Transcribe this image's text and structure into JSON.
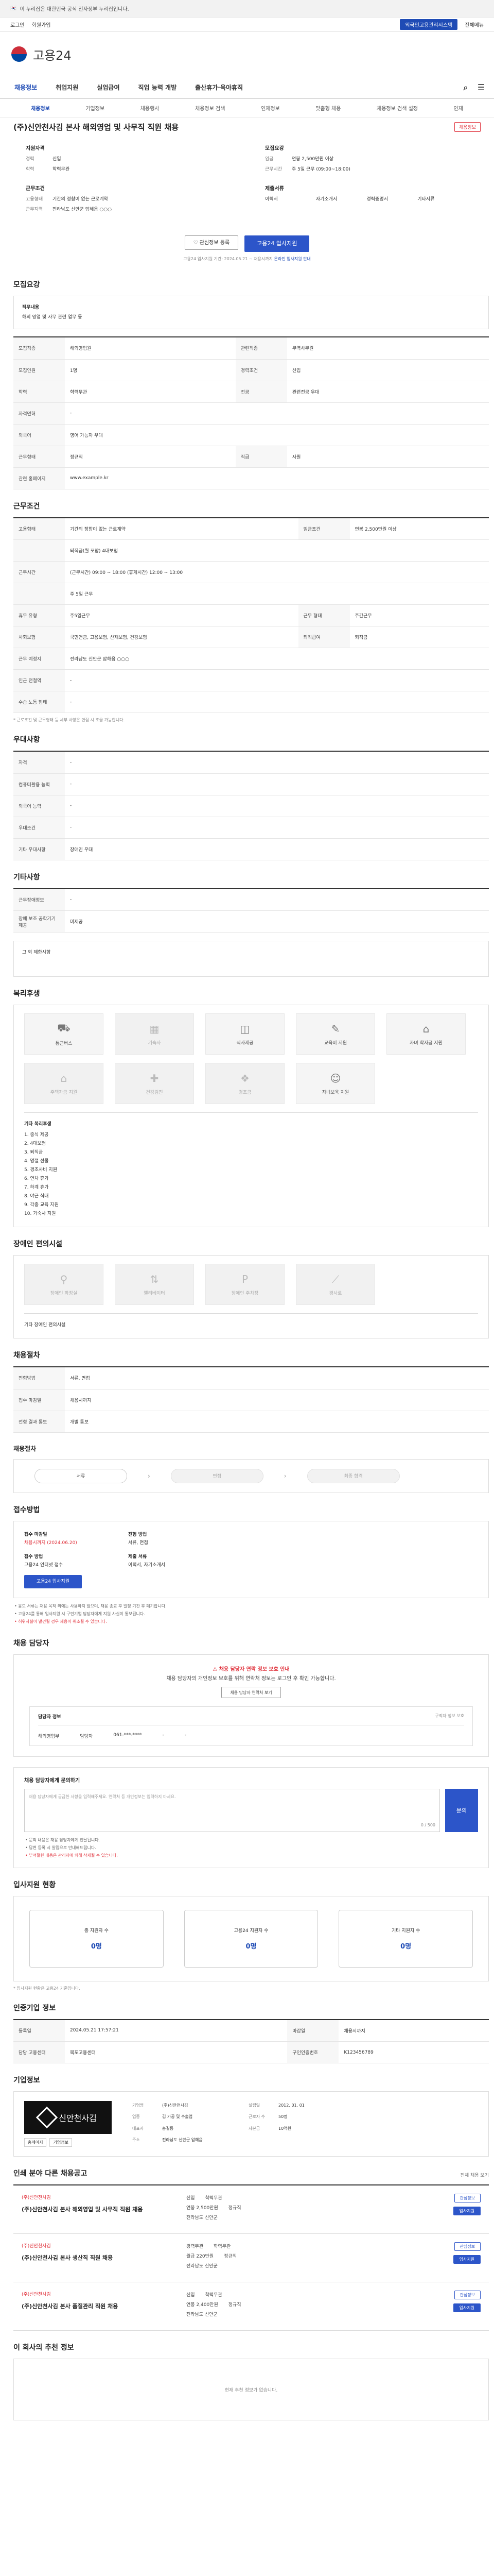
{
  "gov_banner": "이 누리집은 대한민국 공식 전자정부 누리집입니다.",
  "util": {
    "a": "로그인",
    "b": "회원가입",
    "c": "전체메뉴",
    "pill": "외국인고용관리시스템"
  },
  "logo": "고용24",
  "nav": [
    "채용정보",
    "취업지원",
    "실업급여",
    "직업 능력 개발",
    "출산휴가·육아휴직"
  ],
  "subnav": [
    "채용정보",
    "기업정보",
    "채용행사",
    "채용정보 검색",
    "인재정보",
    "맞춤형 채용",
    "채용정보 검색 설정",
    "인재"
  ],
  "job_title": "(주)신안천사김 본사 해외영업 및 사무직 직원 채용",
  "tag": "채용정보",
  "summary": {
    "g1": "지원자격",
    "career_k": "경력",
    "career_v": "신입",
    "edu_k": "학력",
    "edu_v": "학력무관",
    "g2": "근무조건",
    "type_k": "고용형태",
    "type_v": "기간의 정함이 없는 근로계약",
    "place_k": "근무지역",
    "place_v": "전라남도 신안군 압해읍 ○○○",
    "g3": "모집요강",
    "wage_k": "임금",
    "wage_v": "연봉 2,500만원 이상",
    "time_k": "근무시간",
    "time_v": "주 5일 근무 (09:00~18:00)",
    "g4": "제출서류",
    "doc1": "이력서",
    "doc2": "자기소개서",
    "doc3": "경력증명서",
    "doc4": "기타서류"
  },
  "buttons": {
    "scrap": "관심정보 등록",
    "apply": "고용24 입사지원",
    "note_a": "고용24 입사지원 기간: 2024.05.21 ~ 채용시까지",
    "note_b": "온라인 입사지원 안내"
  },
  "sections": {
    "recruit": "모집요강",
    "conditions": "근무조건",
    "extra": "우대사항",
    "other": "기타사항",
    "welfare": "복리후생",
    "facility": "장애인 편의시설",
    "selection": "채용절차",
    "apply": "접수방법",
    "contact": "채용 담당자",
    "stats": "입사지원 현황",
    "info": "인증기업 정보",
    "company": "기업정보",
    "related": "인쇄 분야 다른 채용공고",
    "recommend": "이 회사의 추천 정보"
  },
  "recruit_box": {
    "title": "직무내용",
    "desc": "해외 영업 및 사무 관련 업무 등"
  },
  "recruit_rows": [
    {
      "k": "모집직종",
      "v": "해외영업원",
      "k2": "관련직종",
      "v2": "무역사무원"
    },
    {
      "k": "모집인원",
      "v": "1명",
      "k2": "경력조건",
      "v2": "신입"
    },
    {
      "k": "학력",
      "v": "학력무관",
      "k2": "전공",
      "v2": "관련전공 우대"
    },
    {
      "k": "자격면허",
      "v": "-",
      "k2": "",
      "v2": ""
    },
    {
      "k": "외국어",
      "v": "영어 가능자 우대",
      "k2": "",
      "v2": ""
    },
    {
      "k": "근무형태",
      "v": "정규직",
      "k2": "직급",
      "v2": "사원"
    },
    {
      "k": "관련 홈페이지",
      "v": "www.example.kr",
      "k2": "",
      "v2": ""
    }
  ],
  "condition_rows": [
    {
      "k": "고용형태",
      "v": "기간의 정함이 없는 근로계약",
      "k2": "임금조건",
      "v2": "연봉 2,500만원 이상"
    },
    {
      "k": "",
      "v": "퇴직금(월 포함) 4대보험",
      "k2": "",
      "v2": ""
    },
    {
      "k": "근무시간",
      "v": "(근무시간) 09:00 ~ 18:00 (휴게시간) 12:00 ~ 13:00",
      "k2": "",
      "v2": ""
    },
    {
      "k": "",
      "v": "주 5일 근무",
      "k2": "",
      "v2": ""
    },
    {
      "k": "휴무 유형",
      "v": "주5일근무",
      "k2": "근무 형태",
      "v2": "주간근무"
    },
    {
      "k": "사회보험",
      "v": "국민연금, 고용보험, 산재보험, 건강보험",
      "k2": "퇴직급여",
      "v2": "퇴직금"
    },
    {
      "k": "근무 예정지",
      "v": "전라남도 신안군 압해읍 ○○○",
      "k2": "",
      "v2": ""
    },
    {
      "k": "인근 전철역",
      "v": "-",
      "k2": "",
      "v2": ""
    },
    {
      "k": "수습 노동 형태",
      "v": "-",
      "k2": "",
      "v2": ""
    }
  ],
  "map_btn": "지도 보기",
  "condition_note": "* 근로조건 및 근무형태 등 세부 사항은 면접 시 조율 가능합니다.",
  "extra_rows": [
    {
      "k": "자격",
      "v": "-"
    },
    {
      "k": "컴퓨터활용 능력",
      "v": "-"
    },
    {
      "k": "외국어 능력",
      "v": "-"
    },
    {
      "k": "우대조건",
      "v": "-"
    },
    {
      "k": "기타 우대사항",
      "v": "장애인 우대"
    }
  ],
  "other_rows": [
    {
      "k": "근무장애정보",
      "v": "-"
    },
    {
      "k": "장애 보조 공학기기 제공",
      "v": "미제공"
    }
  ],
  "other_box": "그 외 제한사항",
  "welfare_cards_1": [
    {
      "icon": "car-icon",
      "glyph": "⛟",
      "label": "통근버스",
      "dim": false
    },
    {
      "icon": "building-icon",
      "glyph": "▦",
      "label": "기숙사",
      "dim": true
    },
    {
      "icon": "meal-icon",
      "glyph": "◫",
      "label": "식사제공",
      "dim": false
    },
    {
      "icon": "education-icon",
      "glyph": "✎",
      "label": "교육비 지원",
      "dim": false
    },
    {
      "icon": "graduation-icon",
      "glyph": "⌂",
      "label": "자녀 학자금 지원",
      "dim": false
    }
  ],
  "welfare_cards_2": [
    {
      "icon": "home-icon",
      "glyph": "⌂",
      "label": "주택자금 지원",
      "dim": true
    },
    {
      "icon": "health-icon",
      "glyph": "✚",
      "label": "건강검진",
      "dim": true
    },
    {
      "icon": "gift-icon",
      "glyph": "❖",
      "label": "경조금",
      "dim": true
    },
    {
      "icon": "person-icon",
      "glyph": "☺",
      "label": "자녀보육 지원",
      "dim": false
    }
  ],
  "welfare_list": {
    "title": "기타 복리후생",
    "items": [
      "1. 중식 제공",
      "2. 4대보험",
      "3. 퇴직금",
      "4. 명절 선물",
      "5. 경조사비 지원",
      "6. 연차 휴가",
      "7. 하계 휴가",
      "8. 야근 식대",
      "9. 각종 교육 지원",
      "10. 기숙사 지원"
    ]
  },
  "facility_cards": [
    {
      "icon": "toilet-icon",
      "glyph": "⚲",
      "label": "장애인 화장실",
      "dim": true
    },
    {
      "icon": "elevator-icon",
      "glyph": "⇅",
      "label": "엘리베이터",
      "dim": true
    },
    {
      "icon": "parking-icon",
      "glyph": "P",
      "label": "장애인 주차장",
      "dim": true
    },
    {
      "icon": "ramp-icon",
      "glyph": "⟋",
      "label": "경사로",
      "dim": true
    }
  ],
  "facility_note": "기타 장애인 편의시설",
  "selection_rows": [
    {
      "k": "전형방법",
      "v": "서류, 면접"
    },
    {
      "k": "접수 마감일",
      "v": "채용시까지"
    },
    {
      "k": "전형 결과 통보",
      "v": "개별 통보"
    }
  ],
  "process": [
    "서류",
    "면접",
    "최종 합격"
  ],
  "apply": {
    "k1": "접수 마감일",
    "v1": "채용시까지 (2024.06.20)",
    "k2": "접수 방법",
    "v2": "고용24 인터넷 접수",
    "btn": "고용24 입사지원",
    "k3": "전형 방법",
    "v3": "서류, 면접",
    "k4": "제출 서류",
    "v4": "이력서, 자기소개서"
  },
  "apply_bullets": [
    "• 응모 서류는 채용 목적 외에는 사용하지 않으며, 채용 종료 후 일정 기간 후 폐기합니다.",
    "• 고용24를 통해 입사지원 시 구인기업 담당자에게 지원 사실이 통보됩니다.",
    "• 허위사실이 발견될 경우 채용이 취소될 수 있습니다."
  ],
  "contact": {
    "alert_title": "채용 담당자 연락 정보 보호 안내",
    "alert_body": "채용 담당자의 개인정보 보호를 위해 연락처 정보는 로그인 후 확인 가능합니다.",
    "btn": "채용 담당자 연락처 보기",
    "inner_title": "담당자 정보",
    "inner_note": "구직자 정보 보호",
    "dept": "해외영업부",
    "name": "담당자",
    "phone": "061-***-****",
    "fax": "-",
    "email": "-"
  },
  "inquiry": {
    "title": "채용 담당자에게 문의하기",
    "placeholder": "채용 담당자에게 궁금한 사항을 입력해주세요. 연락처 등 개인정보는 입력하지 마세요.",
    "count": "0 / 500",
    "btn": "문의"
  },
  "inquiry_notes": [
    "• 문의 내용은 채용 담당자에게 전달됩니다.",
    "• 답변 등록 시 알림으로 안내해드립니다.",
    "• 부적절한 내용은 관리자에 의해 삭제될 수 있습니다."
  ],
  "stats": [
    {
      "label": "총 지원자 수",
      "num": "0명"
    },
    {
      "label": "고용24 지원자 수",
      "num": "0명"
    },
    {
      "label": "기타 지원자 수",
      "num": "0명"
    }
  ],
  "stats_note": "* 입사지원 현황은 고용24 기준입니다.",
  "info_rows": [
    {
      "k": "등록일",
      "v": "2024.05.21 17:57:21",
      "k2": "마감일",
      "v2": "채용시까지"
    },
    {
      "k": "담당 고용센터",
      "v": "목포고용센터",
      "k2": "구인인증번호",
      "v2": "K123456789"
    }
  ],
  "company": {
    "logo_text": "신안천사김",
    "link1": "홈페이지",
    "link2": "기업정보",
    "k1": "기업명",
    "v1": "(주)신안천사김",
    "k2": "업종",
    "v2": "김 가공 및 수출업",
    "k3": "대표자",
    "v3": "홍길동",
    "k4": "설립일",
    "v4": "2012. 01. 01",
    "k5": "근로자 수",
    "v5": "50명",
    "k6": "자본금",
    "v6": "10억원",
    "k7": "주소",
    "v7": "전라남도 신안군 압해읍"
  },
  "related_more": "전체 채용 보기",
  "related": [
    {
      "co": "(주)신안천사김",
      "title": "(주)신안천사김 본사 해외영업 및 사무직 직원 채용",
      "r1a": "신입",
      "r1b": "학력무관",
      "r2a": "연봉 2,500만원",
      "r2b": "정규직",
      "r3": "전라남도 신안군",
      "btn": "관심정보",
      "apply": "입사지원"
    },
    {
      "co": "(주)신안천사김",
      "title": "(주)신안천사김 본사 생산직 직원 채용",
      "r1a": "경력무관",
      "r1b": "학력무관",
      "r2a": "월급 220만원",
      "r2b": "정규직",
      "r3": "전라남도 신안군",
      "btn": "관심정보",
      "apply": "입사지원"
    },
    {
      "co": "(주)신안천사김",
      "title": "(주)신안천사김 본사 품질관리 직원 채용",
      "r1a": "신입",
      "r1b": "학력무관",
      "r2a": "연봉 2,400만원",
      "r2b": "정규직",
      "r3": "전라남도 신안군",
      "btn": "관심정보",
      "apply": "입사지원"
    }
  ],
  "recommend_empty": "현재 추천 정보가 없습니다."
}
